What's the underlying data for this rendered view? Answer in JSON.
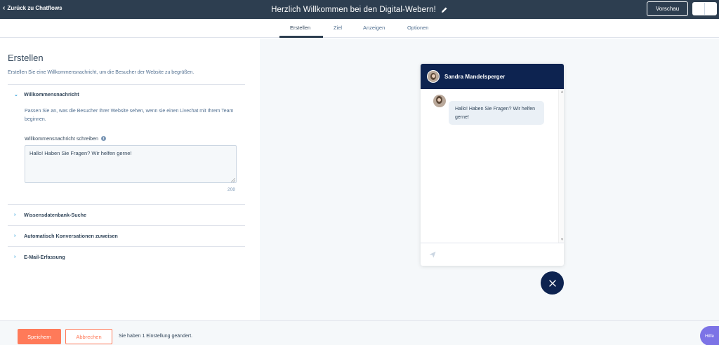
{
  "topbar": {
    "back_label": "Zurück zu Chatflows",
    "title": "Herzlich Willkommen bei den Digital-Webern!",
    "preview_label": "Vorschau"
  },
  "tabs": [
    {
      "label": "Erstellen",
      "active": true
    },
    {
      "label": "Ziel",
      "active": false
    },
    {
      "label": "Anzeigen",
      "active": false
    },
    {
      "label": "Optionen",
      "active": false
    }
  ],
  "left": {
    "heading": "Erstellen",
    "description": "Erstellen Sie eine Willkommensnachricht, um die Besucher der Website zu begrüßen.",
    "sections": [
      {
        "label": "Willkommensnachricht",
        "expanded": true
      },
      {
        "label": "Wissensdatenbank-Suche",
        "expanded": false
      },
      {
        "label": "Automatisch Konversationen zuweisen",
        "expanded": false
      },
      {
        "label": "E-Mail-Erfassung",
        "expanded": false
      }
    ],
    "welcome": {
      "help_text": "Passen Sie an, was die Besucher Ihrer Website sehen, wenn sie einen Livechat mit Ihrem Team beginnen.",
      "field_label": "Willkommensnachricht schreiben",
      "value": "Hallo! Haben Sie Fragen? Wir helfen gerne!",
      "char_count": "208"
    }
  },
  "chat": {
    "agent_name": "Sandra Mandelsperger",
    "message": "Hallo! Haben Sie Fragen? Wir helfen gerne!"
  },
  "footer": {
    "save_label": "Speichern",
    "cancel_label": "Abbrechen",
    "status_text": "Sie haben 1 Einstellung geändert.",
    "help_label": "Hilfe"
  },
  "colors": {
    "topbar": "#2d3e50",
    "accent": "#ff7a59",
    "chat_header": "#0d2350",
    "link": "#2b9dd9",
    "help": "#7c73e6"
  }
}
